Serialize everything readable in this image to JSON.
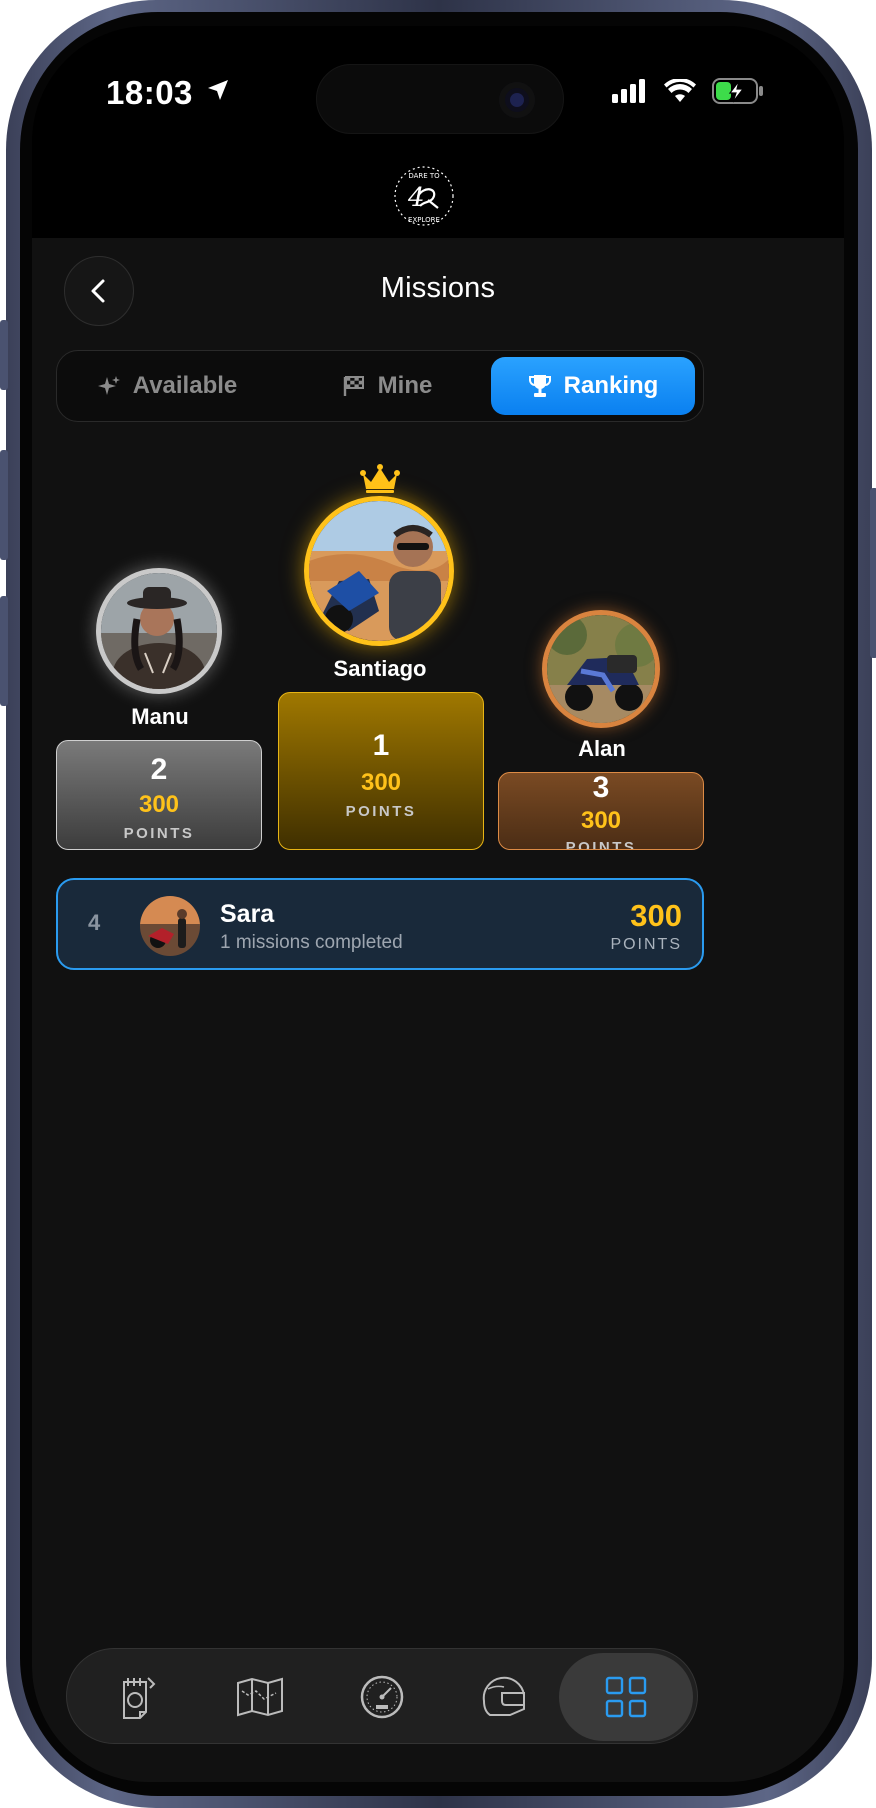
{
  "status_bar": {
    "time": "18:03"
  },
  "header": {
    "title": "Missions"
  },
  "tabs": [
    {
      "label": "Available",
      "icon": "sparkles-icon",
      "active": false
    },
    {
      "label": "Mine",
      "icon": "checkered-flag-icon",
      "active": false
    },
    {
      "label": "Ranking",
      "icon": "trophy-icon",
      "active": true
    }
  ],
  "podium": [
    {
      "rank": "2",
      "name": "Manu",
      "points": "300",
      "points_label": "POINTS"
    },
    {
      "rank": "1",
      "name": "Santiago",
      "points": "300",
      "points_label": "POINTS"
    },
    {
      "rank": "3",
      "name": "Alan",
      "points": "300",
      "points_label": "POINTS"
    }
  ],
  "ranking_list": [
    {
      "rank": "4",
      "name": "Sara",
      "subtitle": "1 missions completed",
      "points": "300",
      "points_label": "POINTS"
    }
  ],
  "bottom_nav": [
    {
      "icon": "notes-icon",
      "active": false
    },
    {
      "icon": "map-icon",
      "active": false
    },
    {
      "icon": "speedometer-icon",
      "active": false
    },
    {
      "icon": "helmet-icon",
      "active": false
    },
    {
      "icon": "grid-icon",
      "active": true
    }
  ],
  "colors": {
    "accent": "#1e90ff",
    "gold": "#ffc21a",
    "silver": "#c9c9c9",
    "bronze": "#d9843f",
    "background": "#111111"
  }
}
